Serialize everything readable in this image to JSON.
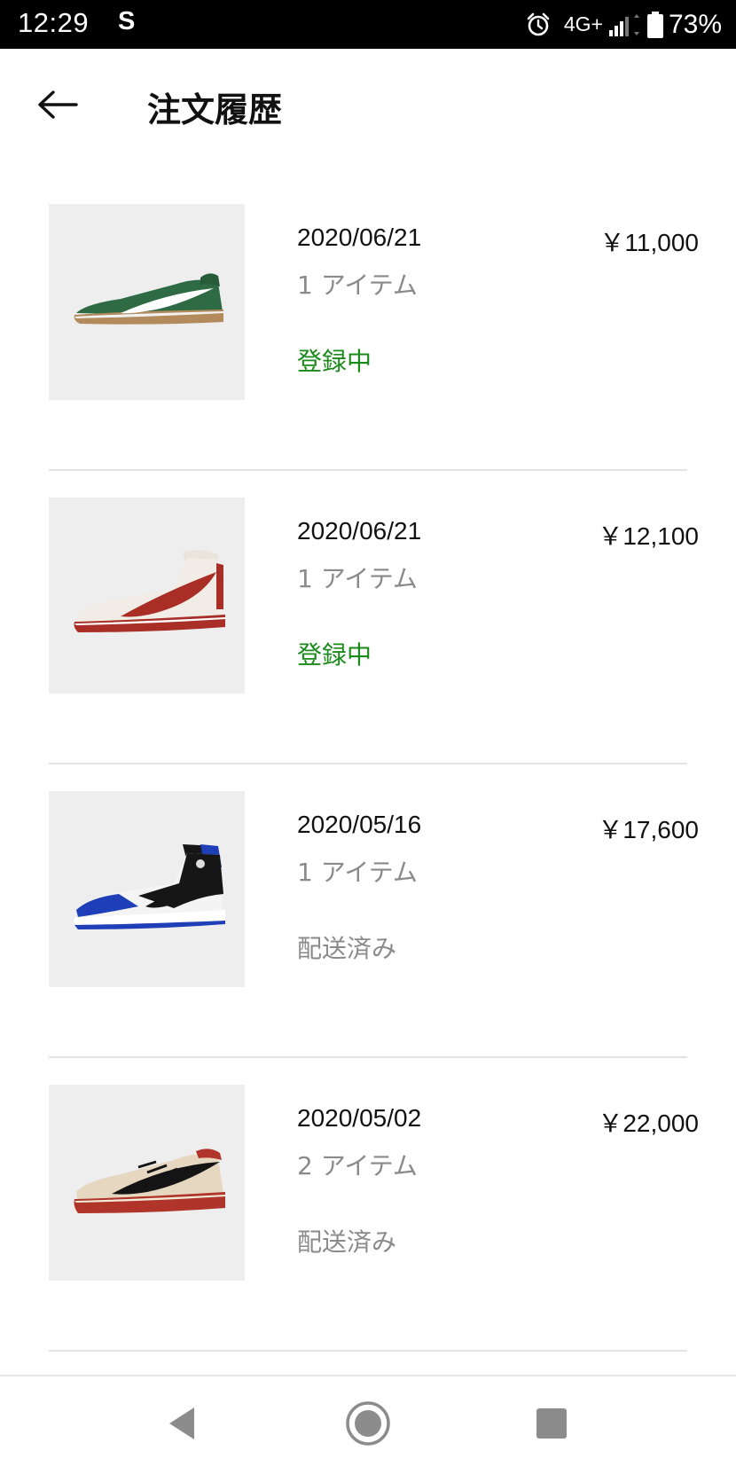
{
  "status_bar": {
    "time": "12:29",
    "app_indicator": "S",
    "network": "4G+",
    "battery": "73%",
    "icons": [
      "alarm-icon",
      "signal-icon",
      "battery-icon"
    ]
  },
  "header": {
    "title": "注文履歴",
    "back_icon": "arrow-left-icon"
  },
  "orders": [
    {
      "date": "2020/06/21",
      "price": "￥11,000",
      "items": "1 アイテム",
      "status": "登録中",
      "status_color": "#1a8a1a",
      "shoe": "green low-top sneaker"
    },
    {
      "date": "2020/06/21",
      "price": "￥12,100",
      "items": "1 アイテム",
      "status": "登録中",
      "status_color": "#1a8a1a",
      "shoe": "white and red high-top sneaker"
    },
    {
      "date": "2020/05/16",
      "price": "￥17,600",
      "items": "1 アイテム",
      "status": "配送済み",
      "status_color": "#8a8a8a",
      "shoe": "blue, black and white high-top sneaker"
    },
    {
      "date": "2020/05/02",
      "price": "￥22,000",
      "items": "2 アイテム",
      "status": "配送済み",
      "status_color": "#8a8a8a",
      "shoe": "cream and red low-top sneaker"
    }
  ],
  "nav_bar": {
    "icons": [
      "triangle-back-icon",
      "circle-home-icon",
      "square-recents-icon"
    ]
  },
  "colors": {
    "accent_green": "#1a8a1a",
    "muted_text": "#8a8a8a",
    "thumb_background": "#eeeeee"
  }
}
